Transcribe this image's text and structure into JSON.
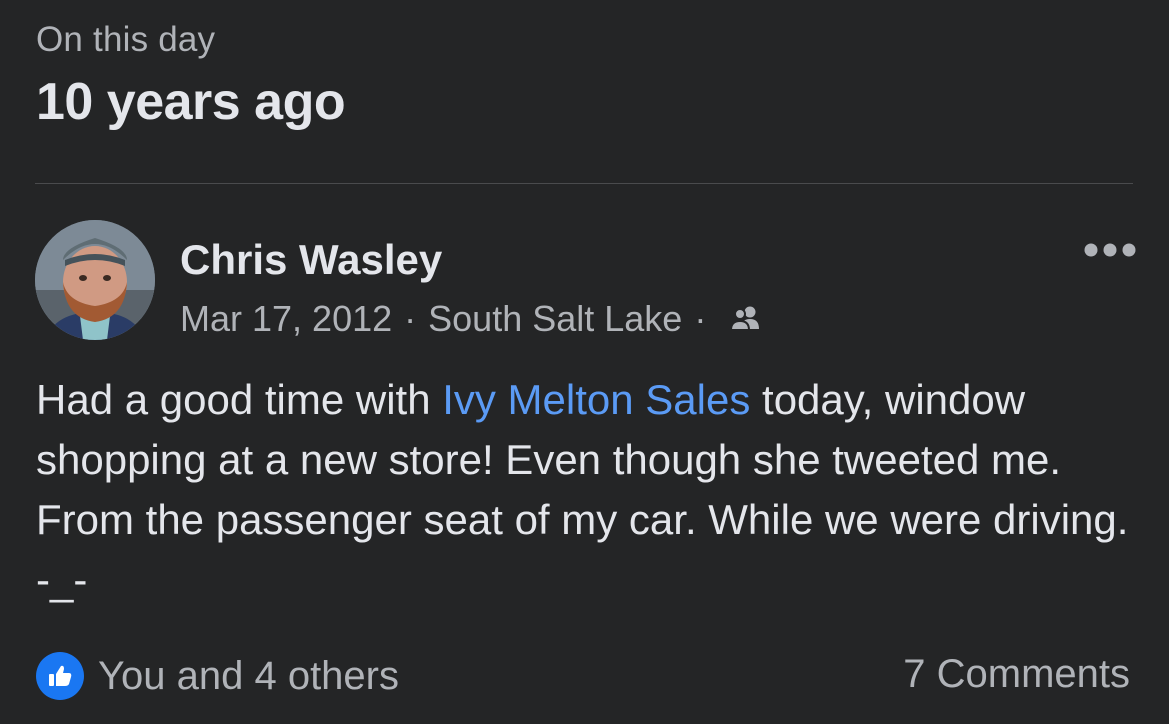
{
  "header": {
    "subtitle": "On this day",
    "title": "10 years ago"
  },
  "post": {
    "author": "Chris Wasley",
    "date": "Mar 17, 2012",
    "separator": "·",
    "location": "South Salt Lake",
    "audience_icon": "friends-icon",
    "text_before": "Had a good time with ",
    "mention": "Ivy Melton Sales",
    "text_after": " today, window shopping at a new store! Even though she tweeted me. From the passenger seat of my car. While we were driving. -_-",
    "more_icon": "more-horizontal-icon"
  },
  "footer": {
    "reaction_icon": "like-icon",
    "reactions_label": "You and 4 others",
    "comments_label": "7 Comments"
  },
  "colors": {
    "background": "#242526",
    "primary_text": "#e4e6eb",
    "secondary_text": "#b0b3b8",
    "mention": "#5b9bf5",
    "like_blue": "#1a77f2"
  }
}
